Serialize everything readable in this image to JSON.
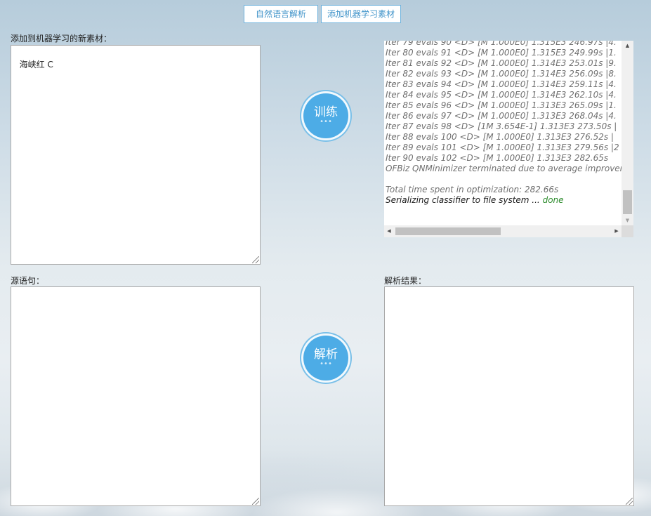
{
  "toolbar": {
    "nlp_parse_label": "自然语言解析",
    "add_ml_material_label": "添加机器学习素材"
  },
  "training": {
    "new_material_label": "添加到机器学习的新素材：",
    "new_material_value": "海峡红 C",
    "train_button_label": "训练",
    "train_button_dots": "•••"
  },
  "log": {
    "lines": [
      {
        "text": "Iter 79 evals 90 <D> [M 1.000E0] 1.315E3 246.97s |4.",
        "style": "normal"
      },
      {
        "text": "Iter 80 evals 91 <D> [M 1.000E0] 1.315E3 249.99s |1.",
        "style": "normal"
      },
      {
        "text": "Iter 81 evals 92 <D> [M 1.000E0] 1.314E3 253.01s |9.",
        "style": "normal"
      },
      {
        "text": "Iter 82 evals 93 <D> [M 1.000E0] 1.314E3 256.09s |8.",
        "style": "normal"
      },
      {
        "text": "Iter 83 evals 94 <D> [M 1.000E0] 1.314E3 259.11s |4.",
        "style": "normal"
      },
      {
        "text": "Iter 84 evals 95 <D> [M 1.000E0] 1.314E3 262.10s |4.",
        "style": "normal"
      },
      {
        "text": "Iter 85 evals 96 <D> [M 1.000E0] 1.313E3 265.09s |1.",
        "style": "normal"
      },
      {
        "text": "Iter 86 evals 97 <D> [M 1.000E0] 1.313E3 268.04s |4.",
        "style": "normal"
      },
      {
        "text": "Iter 87 evals 98 <D> [1M 3.654E-1] 1.313E3 273.50s |",
        "style": "normal"
      },
      {
        "text": "Iter 88 evals 100 <D> [M 1.000E0] 1.313E3 276.52s |",
        "style": "normal"
      },
      {
        "text": "Iter 89 evals 101 <D> [M 1.000E0] 1.313E3 279.56s |2",
        "style": "normal"
      },
      {
        "text": "Iter 90 evals 102 <D> [M 1.000E0] 1.313E3 282.65s",
        "style": "normal"
      },
      {
        "text": "OFBiz QNMinimizer terminated due to average improver",
        "style": "normal"
      },
      {
        "text": "",
        "style": "normal"
      },
      {
        "text": "Total time spent in optimization: 282.66s",
        "style": "normal"
      },
      {
        "text": "Serializing classifier to file system ... ",
        "style": "dark",
        "suffix": "done"
      }
    ],
    "vertical_scroll_position": 0.82,
    "horizontal_scroll_position": 0.0
  },
  "parsing": {
    "source_label": "源语句：",
    "source_value": "",
    "parse_button_label": "解析",
    "parse_button_dots": "•••",
    "result_label": "解析结果：",
    "result_value": ""
  },
  "icons": {
    "scroll_up": "triangle-up",
    "scroll_down": "triangle-down",
    "scroll_left": "triangle-left",
    "scroll_right": "triangle-right"
  },
  "colors": {
    "accent": "#4dace6",
    "button_border": "#6fb2dc",
    "done_text": "#2a8a2a"
  }
}
